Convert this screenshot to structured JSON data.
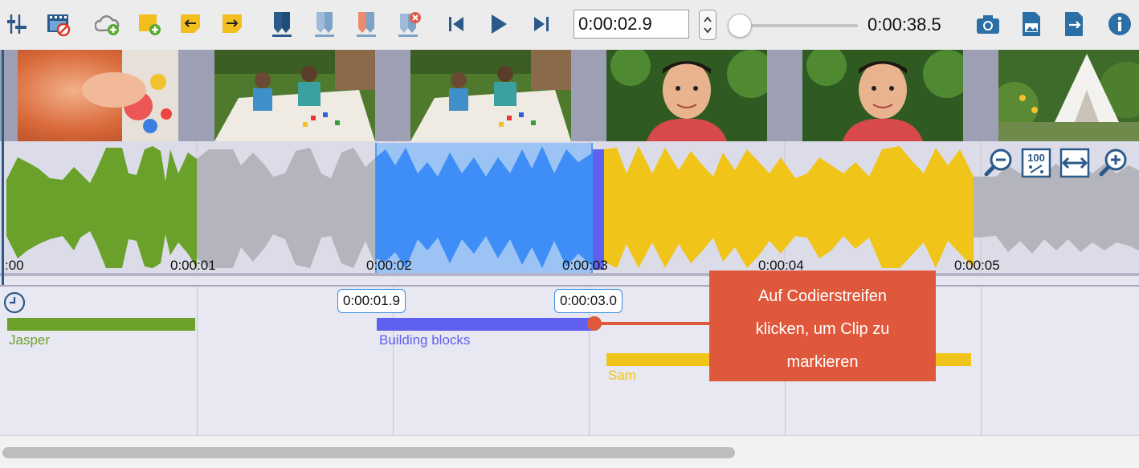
{
  "toolbar": {
    "buttons": [
      {
        "name": "adjust-sliders-icon"
      },
      {
        "name": "video-film-icon"
      },
      {
        "name": "cloud-add-icon"
      },
      {
        "name": "note-add-icon"
      },
      {
        "name": "note-import-icon"
      },
      {
        "name": "note-export-icon"
      },
      {
        "name": "marker-blue-icon"
      },
      {
        "name": "marker-light-icon"
      },
      {
        "name": "marker-multi-icon"
      },
      {
        "name": "marker-delete-icon"
      },
      {
        "name": "skip-back-icon"
      },
      {
        "name": "play-icon"
      },
      {
        "name": "skip-forward-icon"
      }
    ],
    "current_time": "0:00:02.9",
    "duration": "0:00:38.5",
    "position_fraction": 0.075,
    "right_buttons": [
      "camera-icon",
      "image-export-icon",
      "file-export-icon",
      "info-icon"
    ]
  },
  "timeline": {
    "ticks": [
      ":00",
      "0:00:01",
      "0:00:02",
      "0:00:03",
      "0:00:04",
      "0:00:05"
    ],
    "selection_start": "0:00:01.9",
    "selection_end": "0:00:03.0",
    "zoom_buttons": [
      "zoom-out-icon",
      "zoom-100-icon",
      "fit-width-icon",
      "zoom-in-icon"
    ],
    "zoom_100_label": "100"
  },
  "codes": [
    {
      "label": "Jasper",
      "color": "#6aa12a"
    },
    {
      "label": "Building blocks",
      "color": "#6060f0"
    },
    {
      "label": "Sam",
      "color": "#f0c419"
    }
  ],
  "callout": {
    "line1": "Auf Codierstreifen",
    "line2": "klicken, um Clip zu",
    "line3": "markieren",
    "color": "#e0583b"
  },
  "colors": {
    "green": "#6aa12a",
    "gray": "#b4b4bc",
    "blue": "#3f8df6",
    "yellow": "#f0c419",
    "accent": "#2a7de1"
  }
}
